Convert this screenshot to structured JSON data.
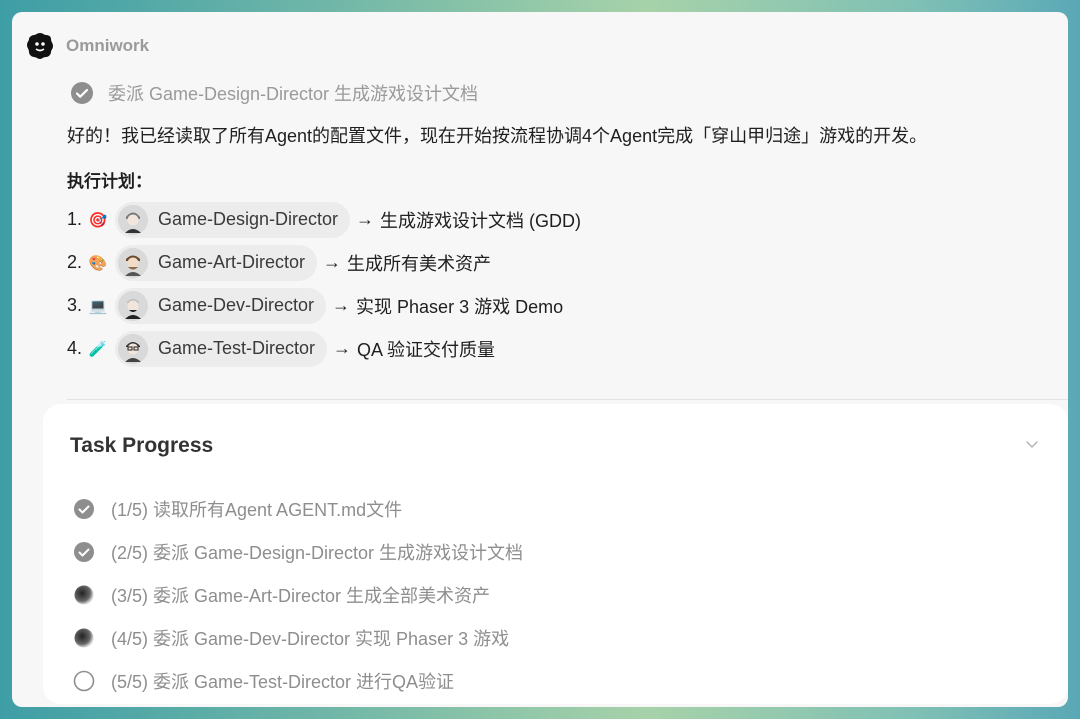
{
  "app": {
    "name": "Omniwork",
    "logo_icon": "omniwork-logo-icon"
  },
  "previous_step": {
    "icon": "check-circle-icon",
    "text": "委派 Game-Design-Director 生成游戏设计文档"
  },
  "message": "好的！我已经读取了所有Agent的配置文件，现在开始按流程协调4个Agent完成「穿山甲归途」游戏的开发。",
  "plan": {
    "title": "执行计划：",
    "items": [
      {
        "num": "1.",
        "emoji": "🎯",
        "agent": "Game-Design-Director",
        "arrow": "→",
        "task": "生成游戏设计文档 (GDD)"
      },
      {
        "num": "2.",
        "emoji": "🎨",
        "agent": "Game-Art-Director",
        "arrow": "→",
        "task": "生成所有美术资产"
      },
      {
        "num": "3.",
        "emoji": "💻",
        "agent": "Game-Dev-Director",
        "arrow": "→",
        "task": "实现 Phaser 3 游戏 Demo"
      },
      {
        "num": "4.",
        "emoji": "🧪",
        "agent": "Game-Test-Director",
        "arrow": "→",
        "task": "QA 验证交付质量"
      }
    ]
  },
  "task_progress": {
    "title": "Task Progress",
    "items": [
      {
        "text": "(1/5) 读取所有Agent AGENT.md文件",
        "status": "done"
      },
      {
        "text": "(2/5) 委派 Game-Design-Director 生成游戏设计文档",
        "status": "done"
      },
      {
        "text": "(3/5) 委派 Game-Art-Director 生成全部美术资产",
        "status": "in-progress"
      },
      {
        "text": "(4/5) 委派 Game-Dev-Director 实现 Phaser 3 游戏",
        "status": "in-progress"
      },
      {
        "text": "(5/5) 委派 Game-Test-Director 进行QA验证",
        "status": "pending"
      }
    ]
  },
  "colors": {
    "accent_gray": "#8e8e8e",
    "card_bg": "#ffffff",
    "window_bg": "#f7f7f7"
  }
}
